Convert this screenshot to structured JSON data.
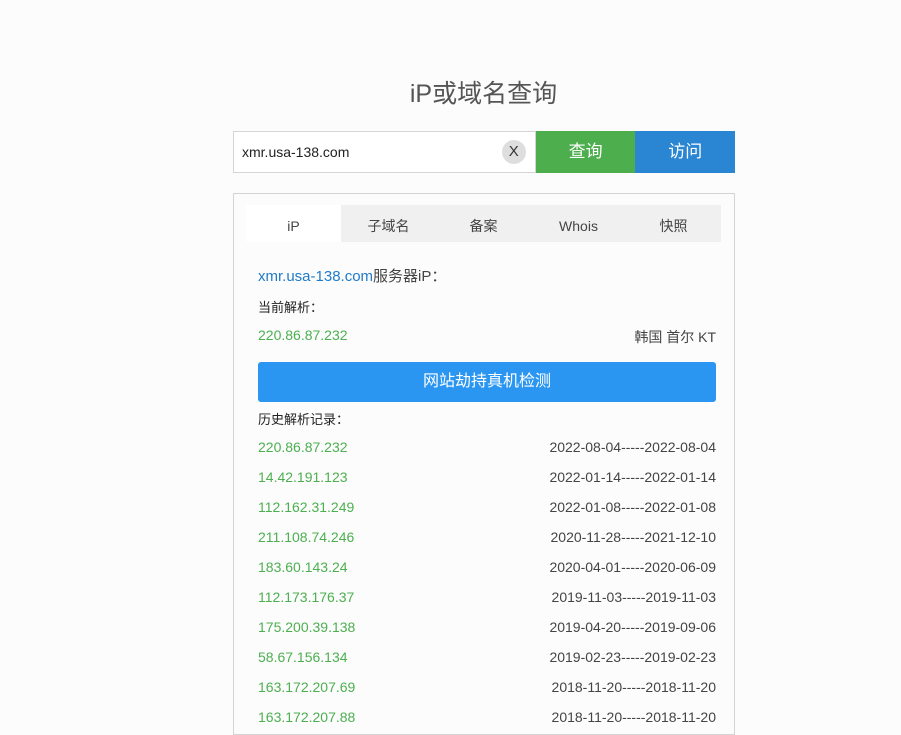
{
  "page": {
    "title": "iP或域名查询"
  },
  "search": {
    "value": "xmr.usa-138.com",
    "clear_label": "X",
    "query_label": "查询",
    "visit_label": "访问"
  },
  "tabs": [
    {
      "label": "iP"
    },
    {
      "label": "子域名"
    },
    {
      "label": "备案"
    },
    {
      "label": "Whois"
    },
    {
      "label": "快照"
    }
  ],
  "result": {
    "domain": "xmr.usa-138.com",
    "suffix": "服务器iP：",
    "current_label": "当前解析：",
    "current": {
      "ip": "220.86.87.232",
      "location": "韩国 首尔 KT"
    },
    "check_button": "网站劫持真机检测",
    "history_label": "历史解析记录：",
    "history": [
      {
        "ip": "220.86.87.232",
        "range": "2022-08-04-----2022-08-04"
      },
      {
        "ip": "14.42.191.123",
        "range": "2022-01-14-----2022-01-14"
      },
      {
        "ip": "112.162.31.249",
        "range": "2022-01-08-----2022-01-08"
      },
      {
        "ip": "211.108.74.246",
        "range": "2020-11-28-----2021-12-10"
      },
      {
        "ip": "183.60.143.24",
        "range": "2020-04-01-----2020-06-09"
      },
      {
        "ip": "112.173.176.37",
        "range": "2019-11-03-----2019-11-03"
      },
      {
        "ip": "175.200.39.138",
        "range": "2019-04-20-----2019-09-06"
      },
      {
        "ip": "58.67.156.134",
        "range": "2019-02-23-----2019-02-23"
      },
      {
        "ip": "163.172.207.69",
        "range": "2018-11-20-----2018-11-20"
      },
      {
        "ip": "163.172.207.88",
        "range": "2018-11-20-----2018-11-20"
      }
    ]
  }
}
